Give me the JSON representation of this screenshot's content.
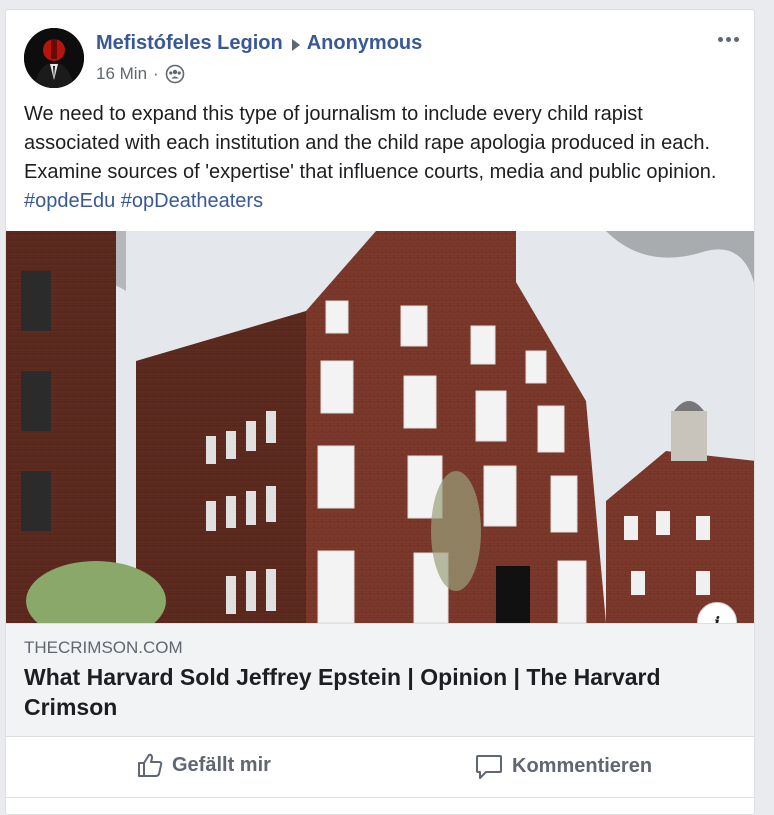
{
  "post": {
    "author": "Mefistófeles Legion",
    "target": "Anonymous",
    "timestamp": "16 Min",
    "separator": "·",
    "privacy_icon": "group-icon",
    "more_icon": "more-horizontal-icon",
    "text": "We need to expand this type of journalism to include every child rapist associated with each institution and the child rape apologia produced in each. Examine sources of 'expertise' that influence courts, media and public opinion.",
    "hashtags": [
      "#opdeEdu",
      "#opDeatheaters"
    ]
  },
  "link_preview": {
    "image_alt": "red brick historic building",
    "info_label": "i",
    "domain": "THECRIMSON.COM",
    "title": "What Harvard Sold Jeffrey Epstein | Opinion | The Harvard Crimson"
  },
  "actions": {
    "like_label": "Gefällt mir",
    "comment_label": "Kommentieren"
  },
  "colors": {
    "link": "#385898",
    "text": "#1c1e21",
    "secondary": "#606770"
  }
}
